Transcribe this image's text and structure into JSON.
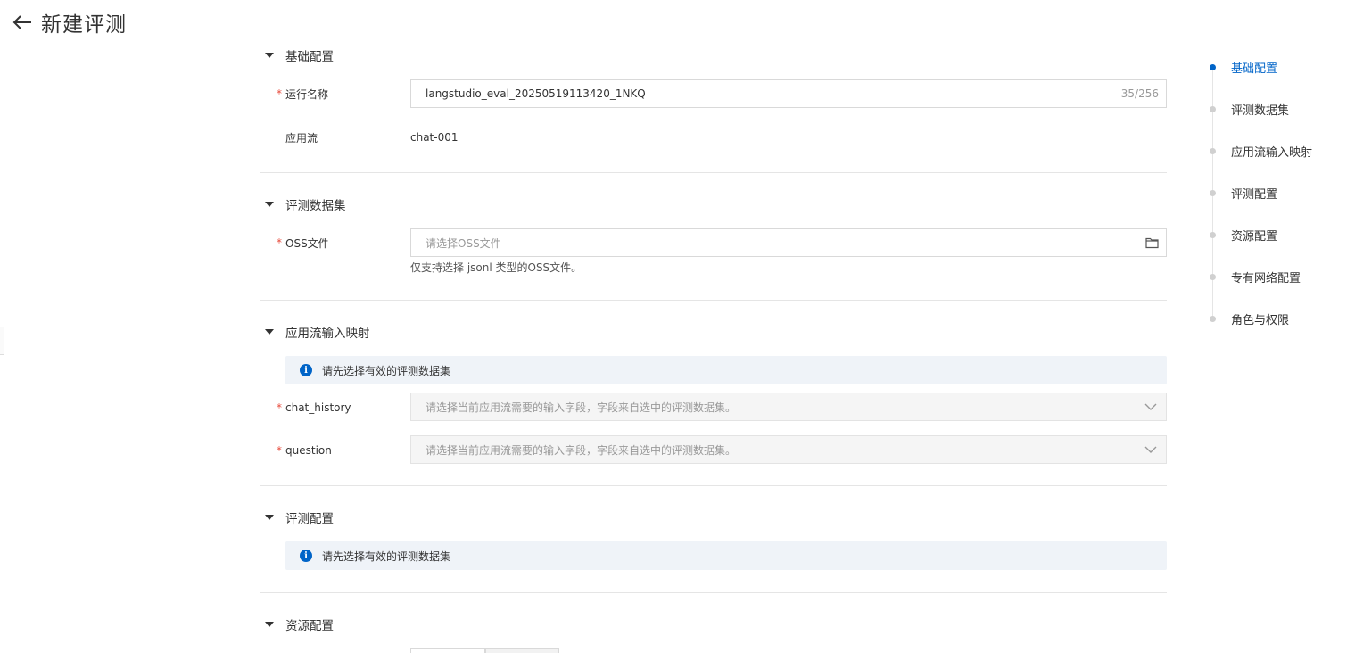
{
  "header": {
    "title": "新建评测"
  },
  "sections": {
    "basic": {
      "title": "基础配置",
      "run_name_label": "运行名称",
      "run_name_value": "langstudio_eval_20250519113420_1NKQ",
      "run_name_count": "35/256",
      "flow_label": "应用流",
      "flow_value": "chat-001"
    },
    "dataset": {
      "title": "评测数据集",
      "oss_label": "OSS文件",
      "oss_placeholder": "请选择OSS文件",
      "oss_helper": "仅支持选择 jsonl 类型的OSS文件。"
    },
    "mapping": {
      "title": "应用流输入映射",
      "alert": "请先选择有效的评测数据集",
      "fields": [
        {
          "label": "chat_history",
          "placeholder": "请选择当前应用流需要的输入字段，字段来自选中的评测数据集。"
        },
        {
          "label": "question",
          "placeholder": "请选择当前应用流需要的输入字段，字段来自选中的评测数据集。"
        }
      ]
    },
    "eval": {
      "title": "评测配置",
      "alert": "请先选择有效的评测数据集"
    },
    "resource": {
      "title": "资源配置"
    }
  },
  "anchor_nav": [
    {
      "label": "基础配置",
      "active": true
    },
    {
      "label": "评测数据集",
      "active": false
    },
    {
      "label": "应用流输入映射",
      "active": false
    },
    {
      "label": "评测配置",
      "active": false
    },
    {
      "label": "资源配置",
      "active": false
    },
    {
      "label": "专有网络配置",
      "active": false
    },
    {
      "label": "角色与权限",
      "active": false
    }
  ],
  "colors": {
    "accent": "#0064c8",
    "required": "#e84c3d",
    "alert_bg": "#eff3f8"
  }
}
